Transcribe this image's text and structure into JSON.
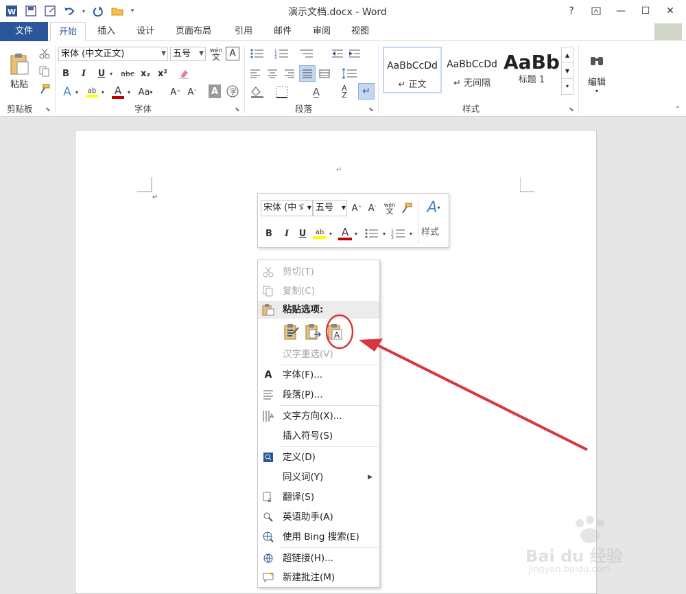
{
  "titlebar": {
    "title": "演示文档.docx - Word",
    "help": "?",
    "minimize": "—",
    "restore": "☐",
    "close": "✕"
  },
  "tabs": [
    "文件",
    "开始",
    "插入",
    "设计",
    "页面布局",
    "引用",
    "邮件",
    "审阅",
    "视图"
  ],
  "ribbon": {
    "clipboard": {
      "paste_label": "粘贴",
      "group_label": "剪贴板"
    },
    "font": {
      "font_name": "宋体 (中文正文)",
      "font_size": "五号",
      "phonetic": "wén文",
      "group_label": "字体",
      "buttons": {
        "bold": "B",
        "italic": "I",
        "underline": "U",
        "strike": "abc",
        "sub": "x₂",
        "sup": "x²",
        "case": "Aa",
        "grow": "A",
        "shrink": "A"
      }
    },
    "paragraph": {
      "group_label": "段落"
    },
    "styles": {
      "group_label": "样式",
      "items": [
        {
          "sample": "AaBbCcDd",
          "name": "↵ 正文"
        },
        {
          "sample": "AaBbCcDd",
          "name": "↵ 无间隔"
        },
        {
          "sample": "AaBb",
          "name": "标题 1"
        }
      ]
    },
    "editing": {
      "label": "编辑"
    }
  },
  "minitoolbar": {
    "font_name": "宋体 (中ゞ",
    "font_size": "五号",
    "styles_label": "样式",
    "bold": "B",
    "italic": "I",
    "underline": "U"
  },
  "context_menu": {
    "items": [
      {
        "label": "剪切(T)",
        "disabled": true
      },
      {
        "label": "复制(C)",
        "disabled": true
      },
      {
        "label": "粘贴选项:",
        "header": true
      },
      {
        "label": "汉字重选(V)",
        "disabled": true
      },
      {
        "label": "字体(F)..."
      },
      {
        "label": "段落(P)..."
      },
      {
        "label": "文字方向(X)..."
      },
      {
        "label": "插入符号(S)"
      },
      {
        "label": "定义(D)"
      },
      {
        "label": "同义词(Y)"
      },
      {
        "label": "翻译(S)"
      },
      {
        "label": "英语助手(A)"
      },
      {
        "label": "使用 Bing 搜索(E)"
      },
      {
        "label": "超链接(H)..."
      },
      {
        "label": "新建批注(M)"
      }
    ]
  },
  "document": {
    "para_mark_1": "↵",
    "para_mark_2": "↵"
  },
  "watermark": {
    "brand": "Bai du 经验",
    "url": "jingyan.baidu.com"
  },
  "colors": {
    "accent": "#2b579a",
    "annotation": "#d9363e",
    "font_red": "#c00000",
    "highlight": "#ffff00"
  }
}
